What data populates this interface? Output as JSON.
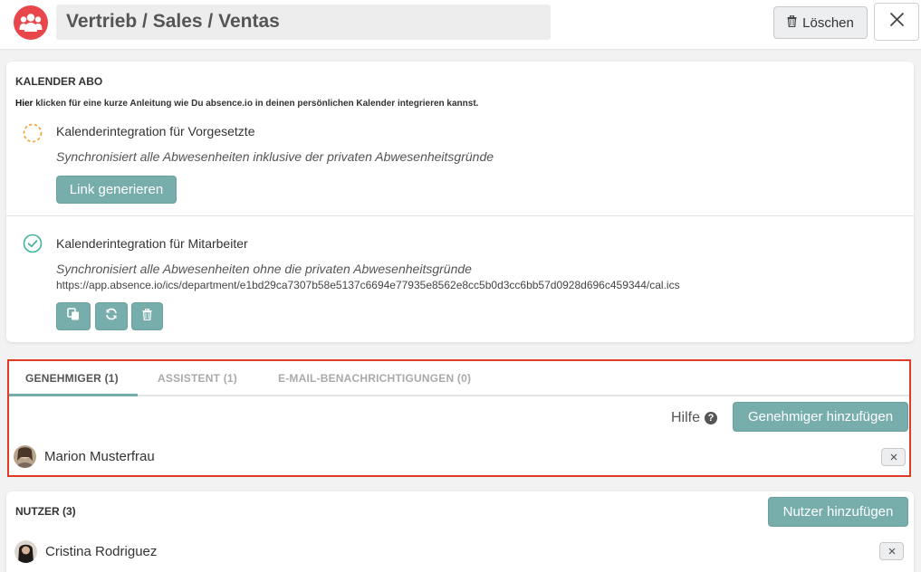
{
  "header": {
    "department_name": "Vertrieb / Sales / Ventas",
    "delete_label": "Löschen"
  },
  "calendar": {
    "title": "KALENDER ABO",
    "hint_bold": "Hier",
    "hint_text": "klicken für eine kurze Anleitung wie Du absence.io in deinen persönlichen Kalender integrieren kannst.",
    "manager": {
      "title": "Kalenderintegration für Vorgesetzte",
      "description": "Synchronisiert alle Abwesenheiten inklusive der privaten Abwesenheitsgründe",
      "button_label": "Link generieren",
      "status": "pending"
    },
    "employee": {
      "title": "Kalenderintegration für Mitarbeiter",
      "description": "Synchronisiert alle Abwesenheiten ohne die privaten Abwesenheitsgründe",
      "url": "https://app.absence.io/ics/department/e1bd29ca7307b58e5137c6694e77935e8562e8cc5b0d3cc6bb57d0928d696c459344/cal.ics",
      "status": "active"
    }
  },
  "tabs": [
    {
      "label": "GENEHMIGER",
      "count": "(1)",
      "active": true
    },
    {
      "label": "ASSISTENT",
      "count": "(1)",
      "active": false
    },
    {
      "label": "E-MAIL-BENACHRICHTIGUNGEN",
      "count": "(0)",
      "active": false
    }
  ],
  "approvers": {
    "help_label": "Hilfe",
    "add_label": "Genehmiger hinzufügen",
    "list": [
      {
        "name": "Marion Musterfrau"
      }
    ]
  },
  "users": {
    "title": "NUTZER (3)",
    "add_label": "Nutzer hinzufügen",
    "list": [
      {
        "name": "Cristina Rodriguez"
      }
    ]
  },
  "colors": {
    "accent_teal": "#77aeab",
    "brand_red": "#e8464a",
    "highlight_red": "#e13b25",
    "pending_orange": "#f0a030",
    "active_green": "#3fb39a"
  }
}
